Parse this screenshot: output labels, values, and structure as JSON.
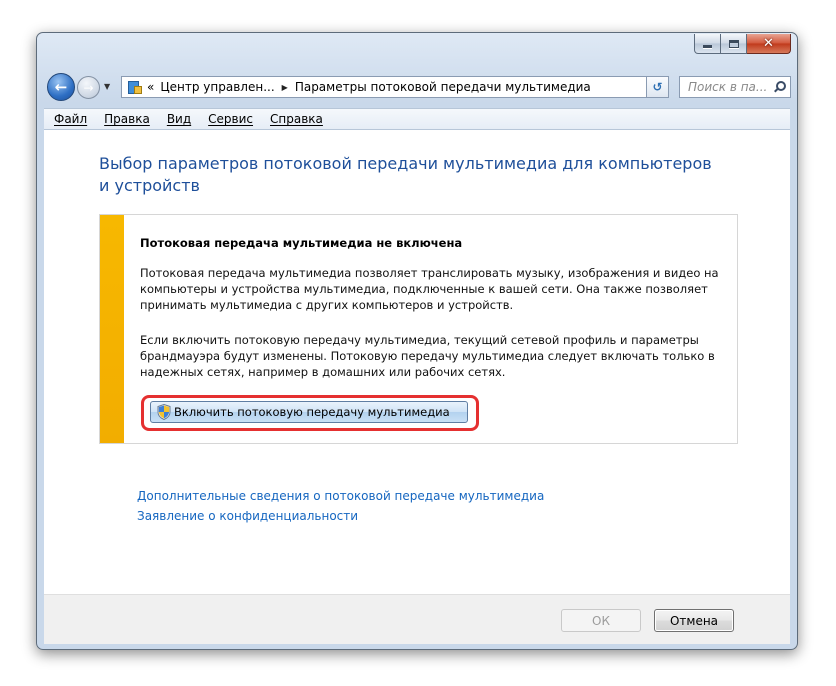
{
  "window": {
    "caption_buttons": {
      "minimize_icon": "minimize-icon",
      "maximize_icon": "maximize-icon",
      "close_label": "✕"
    }
  },
  "navigation": {
    "back_icon": "back-arrow-icon",
    "forward_icon": "forward-arrow-icon",
    "address": {
      "prefix": "«",
      "crumbs": [
        "Центр управлен...",
        "Параметры потоковой передачи мультимедиа"
      ]
    },
    "search": {
      "placeholder": "Поиск в па..."
    }
  },
  "menu": [
    "Файл",
    "Правка",
    "Вид",
    "Сервис",
    "Справка"
  ],
  "main": {
    "heading": "Выбор параметров потоковой передачи мультимедиа для компьютеров и устройств",
    "info_box": {
      "title": "Потоковая передача мультимедиа не включена",
      "paragraph1": "Потоковая передача мультимедиа позволяет транслировать музыку, изображения и видео на компьютеры и устройства мультимедиа, подключенные к вашей сети. Она также позволяет принимать мультимедиа с других компьютеров и устройств.",
      "paragraph2": "Если включить потоковую передачу мультимедиа, текущий сетевой профиль и параметры брандмауэра будут изменены. Потоковую передачу мультимедиа следует включать только в надежных сетях, например в домашних или рабочих сетях.",
      "enable_button": "Включить потоковую передачу мультимедиа",
      "accent_color": "#f5b400",
      "highlight_color": "#e53030"
    },
    "links": [
      "Дополнительные сведения о потоковой передаче мультимедиа",
      "Заявление о конфиденциальности"
    ]
  },
  "footer": {
    "ok_label": "ОК",
    "ok_enabled": false,
    "cancel_label": "Отмена"
  }
}
